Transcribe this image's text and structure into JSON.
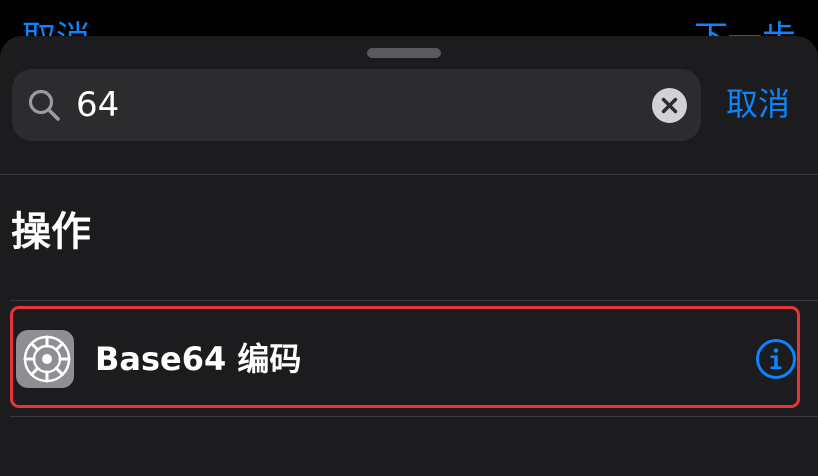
{
  "background_nav": {
    "left_label": "取消",
    "right_label": "下一步"
  },
  "search": {
    "value": "64",
    "placeholder": "",
    "cancel_label": "取消"
  },
  "section": {
    "title": "操作"
  },
  "results": [
    {
      "label": "Base64 编码",
      "icon": "gear-icon",
      "info_icon": "info-icon",
      "highlighted": true
    }
  ],
  "colors": {
    "accent": "#0A84FF",
    "highlight": "#E5343A",
    "sheet_bg": "#1C1C1E",
    "field_bg": "#2C2C2E"
  }
}
